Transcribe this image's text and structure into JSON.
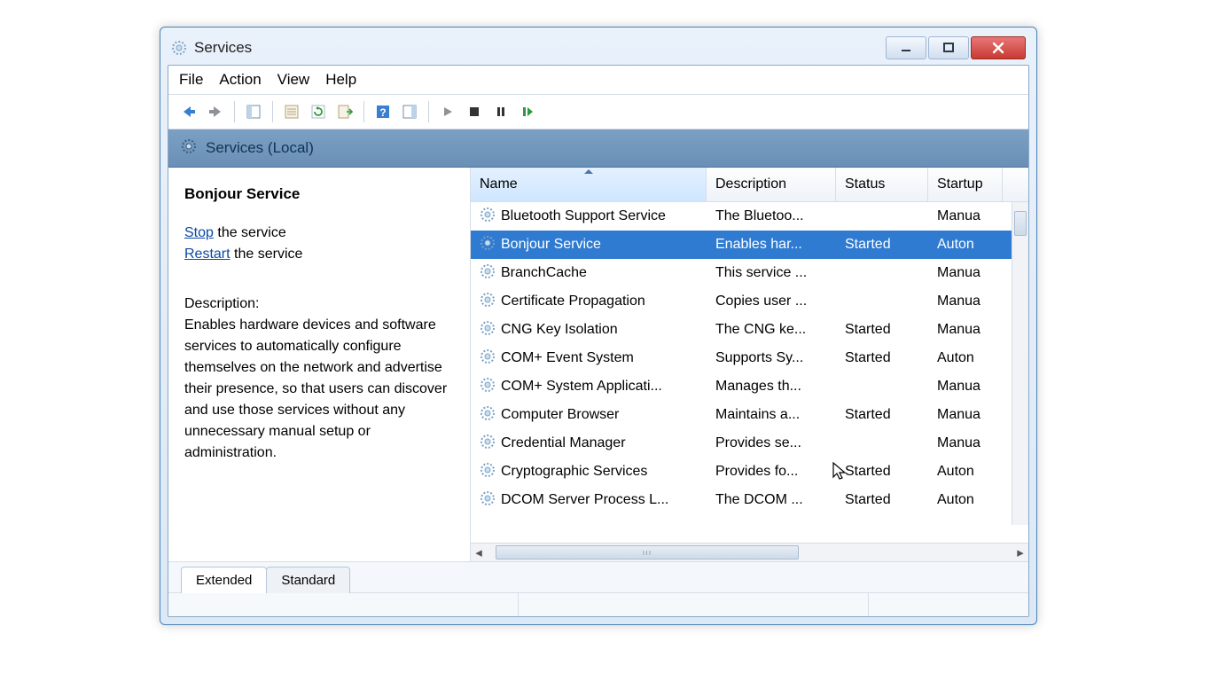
{
  "window_title": "Services",
  "menus": {
    "file": "File",
    "action": "Action",
    "view": "View",
    "help": "Help"
  },
  "crumb": "Services (Local)",
  "details": {
    "name": "Bonjour Service",
    "action_stop": "Stop",
    "action_stop_suffix": " the service",
    "action_restart": "Restart",
    "action_restart_suffix": " the service",
    "desc_label": "Description:",
    "desc": "Enables hardware devices and software services to automatically configure themselves on the network and advertise their presence, so that users can discover and use those services without any unnecessary manual setup or administration."
  },
  "columns": {
    "name": "Name",
    "desc": "Description",
    "status": "Status",
    "startup": "Startup"
  },
  "rows": [
    {
      "name": "Bluetooth Support Service",
      "desc": "The Bluetoo...",
      "status": "",
      "startup": "Manua"
    },
    {
      "name": "Bonjour Service",
      "desc": "Enables har...",
      "status": "Started",
      "startup": "Auton",
      "selected": true
    },
    {
      "name": "BranchCache",
      "desc": "This service ...",
      "status": "",
      "startup": "Manua"
    },
    {
      "name": "Certificate Propagation",
      "desc": "Copies user ...",
      "status": "",
      "startup": "Manua"
    },
    {
      "name": "CNG Key Isolation",
      "desc": "The CNG ke...",
      "status": "Started",
      "startup": "Manua"
    },
    {
      "name": "COM+ Event System",
      "desc": "Supports Sy...",
      "status": "Started",
      "startup": "Auton"
    },
    {
      "name": "COM+ System Applicati...",
      "desc": "Manages th...",
      "status": "",
      "startup": "Manua"
    },
    {
      "name": "Computer Browser",
      "desc": "Maintains a...",
      "status": "Started",
      "startup": "Manua"
    },
    {
      "name": "Credential Manager",
      "desc": "Provides se...",
      "status": "",
      "startup": "Manua"
    },
    {
      "name": "Cryptographic Services",
      "desc": "Provides fo...",
      "status": "Started",
      "startup": "Auton"
    },
    {
      "name": "DCOM Server Process L...",
      "desc": "The DCOM ...",
      "status": "Started",
      "startup": "Auton"
    }
  ],
  "tabs": {
    "extended": "Extended",
    "standard": "Standard"
  }
}
